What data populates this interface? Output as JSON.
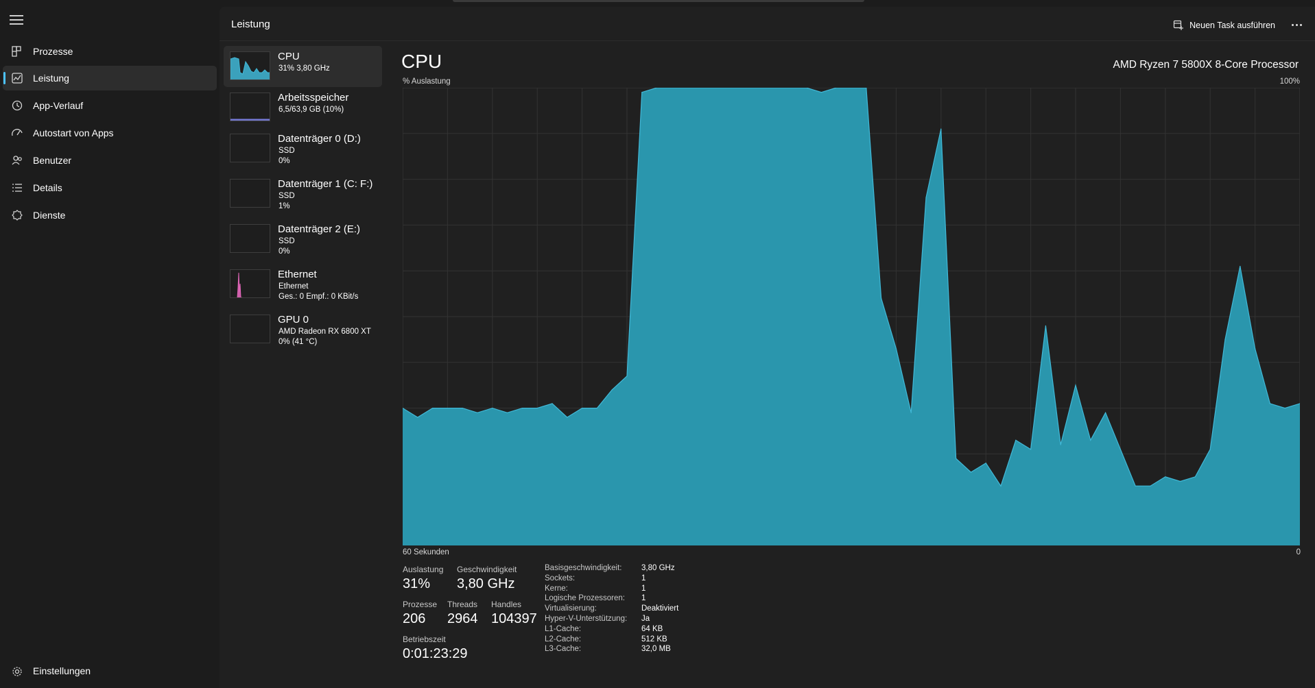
{
  "nav": {
    "items": [
      {
        "label": "Prozesse",
        "icon": "processes-icon"
      },
      {
        "label": "Leistung",
        "icon": "performance-icon"
      },
      {
        "label": "App-Verlauf",
        "icon": "history-icon"
      },
      {
        "label": "Autostart von Apps",
        "icon": "startup-icon"
      },
      {
        "label": "Benutzer",
        "icon": "users-icon"
      },
      {
        "label": "Details",
        "icon": "details-icon"
      },
      {
        "label": "Dienste",
        "icon": "services-icon"
      }
    ],
    "settings_label": "Einstellungen",
    "active": "Leistung"
  },
  "header": {
    "title": "Leistung",
    "run_task_label": "Neuen Task ausführen"
  },
  "devices": [
    {
      "name": "CPU",
      "line1": "31% 3,80 GHz",
      "line2": "",
      "color": "#41b9d8"
    },
    {
      "name": "Arbeitsspeicher",
      "line1": "6,5/63,9 GB (10%)",
      "line2": "",
      "color": "#7a7fe0"
    },
    {
      "name": "Datenträger 0 (D:)",
      "line1": "SSD",
      "line2": "0%",
      "color": "#3fb86a"
    },
    {
      "name": "Datenträger 1 (C: F:)",
      "line1": "SSD",
      "line2": "1%",
      "color": "#3fb86a"
    },
    {
      "name": "Datenträger 2 (E:)",
      "line1": "SSD",
      "line2": "0%",
      "color": "#3fb86a"
    },
    {
      "name": "Ethernet",
      "line1": "Ethernet",
      "line2": "Ges.: 0 Empf.: 0 KBit/s",
      "color": "#e066b8"
    },
    {
      "name": "GPU 0",
      "line1": "AMD Radeon RX 6800 XT",
      "line2": "0% (41 °C)",
      "color": "#9a7fe0"
    }
  ],
  "cpu": {
    "title": "CPU",
    "model": "AMD Ryzen 7 5800X 8-Core Processor",
    "y_label": "% Auslastung",
    "y_max_label": "100%",
    "x_label": "60 Sekunden",
    "x_end_label": "0",
    "stats": {
      "util_label": "Auslastung",
      "util_value": "31%",
      "speed_label": "Geschwindigkeit",
      "speed_value": "3,80 GHz",
      "proc_label": "Prozesse",
      "proc_value": "206",
      "threads_label": "Threads",
      "threads_value": "2964",
      "handles_label": "Handles",
      "handles_value": "104397",
      "uptime_label": "Betriebszeit",
      "uptime_value": "0:01:23:29"
    },
    "specs": [
      {
        "k": "Basisgeschwindigkeit:",
        "v": "3,80 GHz"
      },
      {
        "k": "Sockets:",
        "v": "1"
      },
      {
        "k": "Kerne:",
        "v": "1"
      },
      {
        "k": "Logische Prozessoren:",
        "v": "1"
      },
      {
        "k": "Virtualisierung:",
        "v": "Deaktiviert"
      },
      {
        "k": "Hyper-V-Unterstützung:",
        "v": "Ja"
      },
      {
        "k": "L1-Cache:",
        "v": "64 KB"
      },
      {
        "k": "L2-Cache:",
        "v": "512 KB"
      },
      {
        "k": "L3-Cache:",
        "v": "32,0 MB"
      }
    ],
    "graph_color": "#2a96ad",
    "graph_line_color": "#41b9d8"
  },
  "chart_data": {
    "type": "area",
    "xlim": [
      60,
      0
    ],
    "ylim": [
      0,
      100
    ],
    "grid": true,
    "x": [
      60,
      59,
      58,
      57,
      56,
      55,
      54,
      53,
      52,
      51,
      50,
      49,
      48,
      47,
      46,
      45,
      44,
      43,
      42,
      41,
      40,
      39,
      38,
      37,
      36,
      35,
      34,
      33,
      32,
      31,
      30,
      29,
      28,
      27,
      26,
      25,
      24,
      23,
      22,
      21,
      20,
      19,
      18,
      17,
      16,
      15,
      14,
      13,
      12,
      11,
      10,
      9,
      8,
      7,
      6,
      5,
      4,
      3,
      2,
      1,
      0
    ],
    "series": [
      {
        "values": [
          30,
          28,
          30,
          30,
          30,
          29,
          30,
          29,
          30,
          30,
          31,
          28,
          30,
          30,
          34,
          37,
          99,
          100,
          100,
          100,
          100,
          100,
          100,
          100,
          100,
          100,
          100,
          100,
          99,
          100,
          100,
          100,
          54,
          43,
          29,
          76,
          91,
          19,
          16,
          18,
          13,
          23,
          21,
          48,
          22,
          35,
          23,
          29,
          21,
          13,
          13,
          15,
          14,
          15,
          21,
          45,
          61,
          43,
          31,
          30,
          31
        ]
      }
    ]
  }
}
